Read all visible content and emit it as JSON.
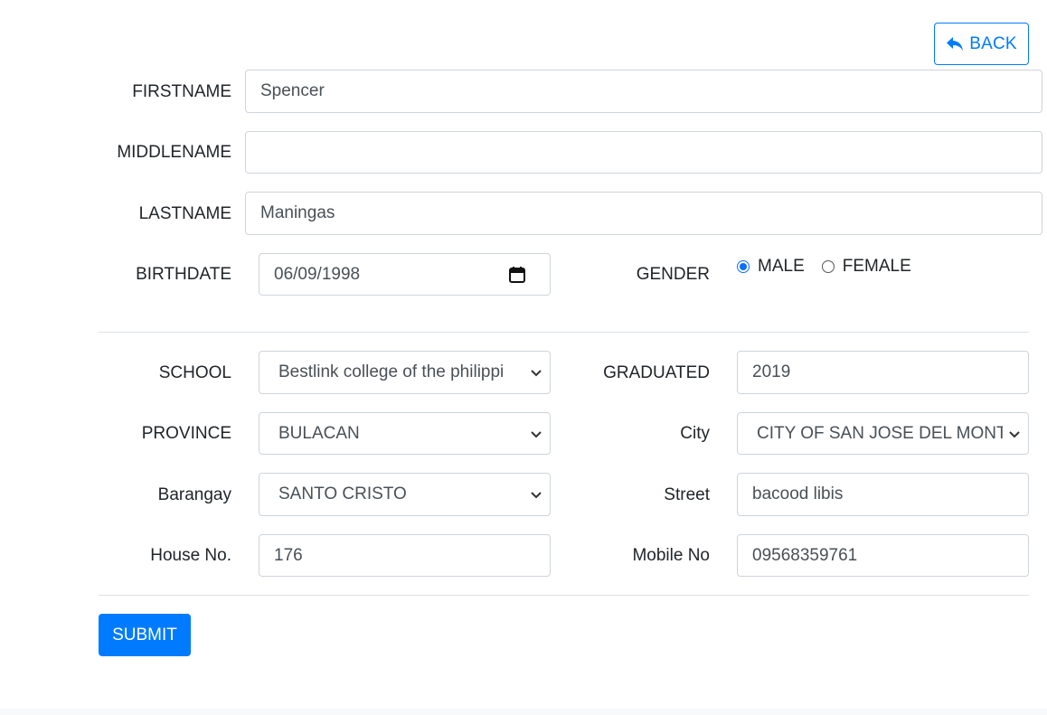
{
  "header": {
    "back_label": "BACK"
  },
  "form": {
    "firstname": {
      "label": "FIRSTNAME",
      "value": "Spencer"
    },
    "middlename": {
      "label": "MIDDLENAME",
      "value": ""
    },
    "lastname": {
      "label": "LASTNAME",
      "value": "Maningas"
    },
    "birthdate": {
      "label": "BIRTHDATE",
      "value": "06/09/1998"
    },
    "gender": {
      "label": "GENDER",
      "options": [
        {
          "label": "MALE",
          "checked": true
        },
        {
          "label": "FEMALE",
          "checked": false
        }
      ]
    },
    "school": {
      "label": "SCHOOL",
      "value": "Bestlink college of the philippi"
    },
    "graduated": {
      "label": "GRADUATED",
      "value": "2019"
    },
    "province": {
      "label": "PROVINCE",
      "value": "BULACAN"
    },
    "city": {
      "label": "City",
      "value": "CITY OF SAN JOSE DEL MONT"
    },
    "barangay": {
      "label": "Barangay",
      "value": "SANTO CRISTO"
    },
    "street": {
      "label": "Street",
      "value": "bacood libis"
    },
    "house_no": {
      "label": "House No.",
      "value": "176"
    },
    "mobile_no": {
      "label": "Mobile No",
      "value": "09568359761"
    },
    "submit_label": "SUBMIT"
  },
  "colors": {
    "primary": "#007bff",
    "border": "#ced4da",
    "divider": "#dee2e6"
  },
  "icons": {
    "back": "reply-arrow-icon",
    "calendar": "calendar-icon",
    "select": "chevron-down-icon"
  }
}
